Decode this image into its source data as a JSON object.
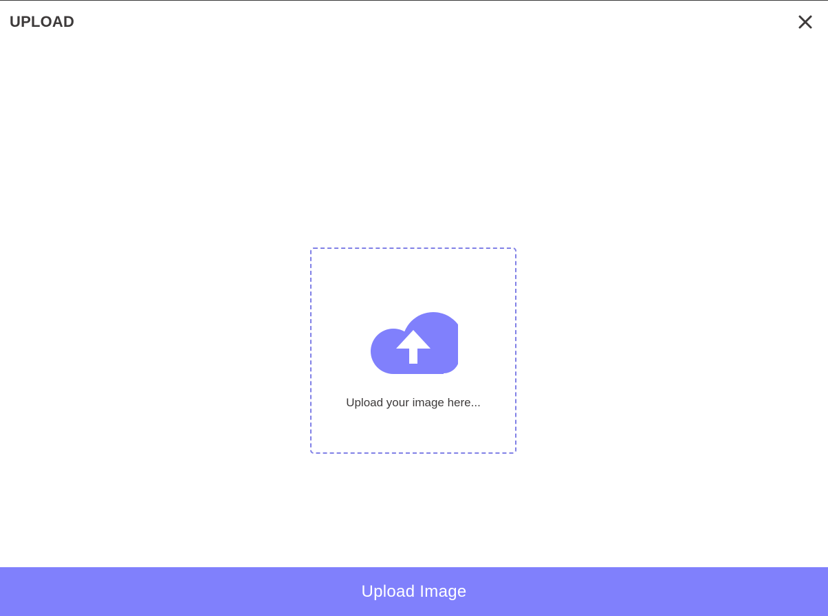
{
  "dialog": {
    "title": "UPLOAD",
    "close_icon": "close-icon"
  },
  "drop_zone": {
    "icon": "cloud-upload-icon",
    "label": "Upload your image here...",
    "border_color": "#8080e6"
  },
  "footer": {
    "upload_button_label": "Upload Image",
    "accent_color": "#8080fc"
  },
  "colors": {
    "text": "#3d3a3a",
    "icon_fill": "#8080fc",
    "background": "#ffffff"
  }
}
